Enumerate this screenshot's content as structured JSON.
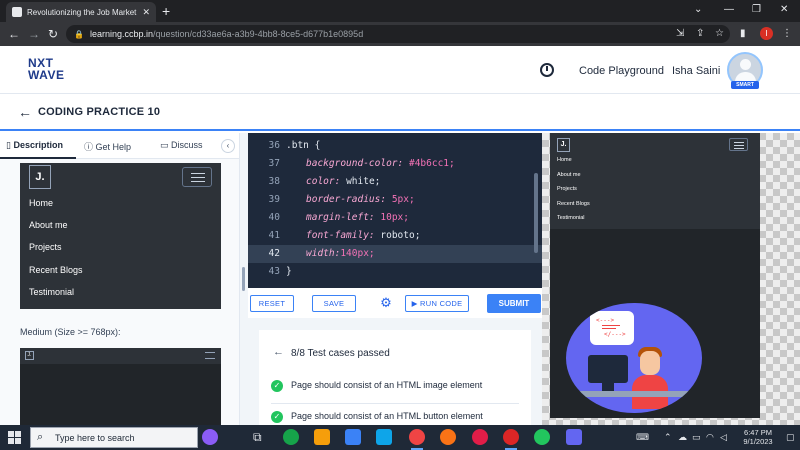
{
  "browser": {
    "tab_title": "Revolutionizing the Job Market |",
    "tab_close": "✕",
    "new_tab": "+",
    "url_host": "learning.ccbp.in",
    "url_path": "/question/cd33ae6a-a3b9-4bb8-8ce5-d677b1e0895d",
    "profile_initial": "I",
    "controls": {
      "minimize": "—",
      "maximize": "❐",
      "close": "✕",
      "chevron": "⌄"
    }
  },
  "header": {
    "logo_line1": "NXT",
    "logo_line2": "WAVE",
    "code_playground": "Code Playground",
    "user_name": "Isha Saini",
    "avatar_badge": "SMART"
  },
  "practice": {
    "title": "CODING PRACTICE 10"
  },
  "left_panel": {
    "tabs": [
      {
        "label": "Description",
        "icon": "document-icon"
      },
      {
        "label": "Get Help",
        "icon": "help-circle-icon"
      },
      {
        "label": "Discuss",
        "icon": "chat-icon"
      }
    ],
    "collapse": "‹",
    "preview_small": {
      "logo": "J.",
      "items": [
        "Home",
        "About me",
        "Projects",
        "Recent Blogs",
        "Testimonial"
      ]
    },
    "medium_label": "Medium (Size >= 768px):",
    "preview_medium_logo": "J."
  },
  "editor": {
    "lines": [
      {
        "num": "36",
        "fold": true,
        "selector": ".btn {"
      },
      {
        "num": "37",
        "prop": "background-color:",
        "value": "#4b6cc1;"
      },
      {
        "num": "38",
        "prop": "color:",
        "value": "white;"
      },
      {
        "num": "39",
        "prop": "border-radius:",
        "value": "5px;"
      },
      {
        "num": "40",
        "prop": "margin-left:",
        "value": "10px;"
      },
      {
        "num": "41",
        "prop": "font-family:",
        "value": "roboto;"
      },
      {
        "num": "42",
        "prop": "width:",
        "value": "140px;"
      },
      {
        "num": "43",
        "selector": "}"
      }
    ],
    "buttons": {
      "reset": "RESET",
      "save": "SAVE",
      "run": "RUN CODE",
      "submit": "SUBMIT"
    }
  },
  "results": {
    "summary": "8/8 Test cases passed",
    "cases": [
      "Page should consist of an HTML image element",
      "Page should consist of an HTML button element"
    ]
  },
  "right_preview": {
    "logo": "J.",
    "items": [
      "Home",
      "About me",
      "Projects",
      "Recent Blogs",
      "Testimonial"
    ],
    "illustration_code_top": "<--->",
    "illustration_code_bottom": "</--->"
  },
  "taskbar": {
    "search_placeholder": "Type here to search",
    "time": "6:47 PM",
    "date": "9/1/2023"
  },
  "colors": {
    "accent": "#3b82f6",
    "editor_bg": "#1e293b",
    "pass_green": "#22c55e",
    "preview_dark": "#2d3238"
  }
}
